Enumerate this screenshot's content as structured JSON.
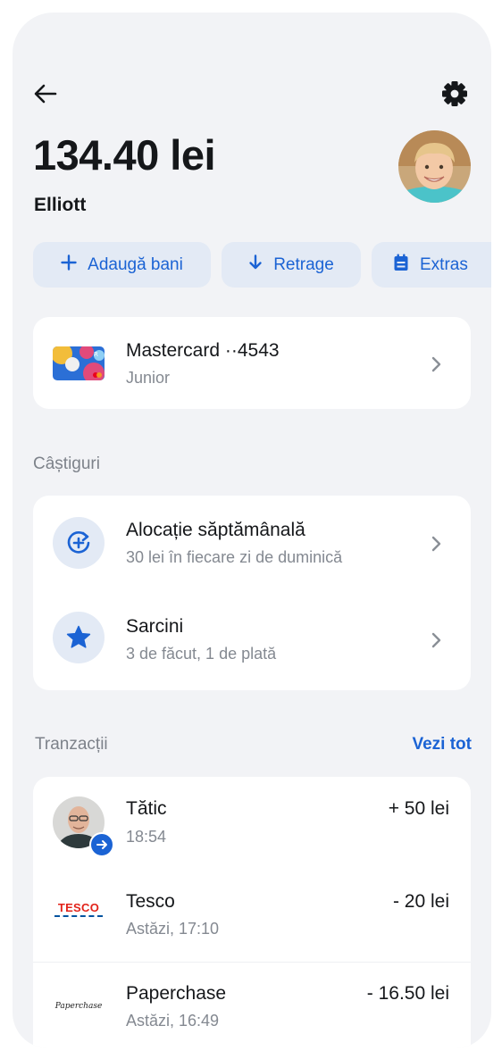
{
  "header": {
    "balance": "134.40 lei",
    "name": "Elliott"
  },
  "actions": [
    {
      "label": "Adaugă bani",
      "icon": "plus-icon"
    },
    {
      "label": "Retrage",
      "icon": "arrow-down-icon"
    },
    {
      "label": "Extras",
      "icon": "statement-icon"
    }
  ],
  "card": {
    "title": "Mastercard ··4543",
    "subtitle": "Junior"
  },
  "earnings": {
    "section_label": "Câștiguri",
    "items": [
      {
        "title": "Alocație săptămânală",
        "subtitle": "30 lei în fiecare zi de duminică",
        "icon": "recurring-plus-icon"
      },
      {
        "title": "Sarcini",
        "subtitle": "3 de făcut, 1 de plată",
        "icon": "star-icon"
      }
    ]
  },
  "transactions": {
    "section_label": "Tranzacții",
    "see_all": "Vezi tot",
    "items": [
      {
        "title": "Tătic",
        "time": "18:54",
        "amount": "+ 50 lei"
      },
      {
        "title": "Tesco",
        "time": "Astăzi, 17:10",
        "amount": "- 20 lei",
        "logo_text": "TESCO"
      },
      {
        "title": "Paperchase",
        "time": "Astăzi, 16:49",
        "amount": "- 16.50 lei",
        "logo_text": "Paperchase"
      }
    ]
  },
  "colors": {
    "accent": "#1b63d4",
    "background": "#f2f3f6",
    "pill_bg": "#e3eaf5",
    "text": "#15171a",
    "muted": "#848991"
  }
}
